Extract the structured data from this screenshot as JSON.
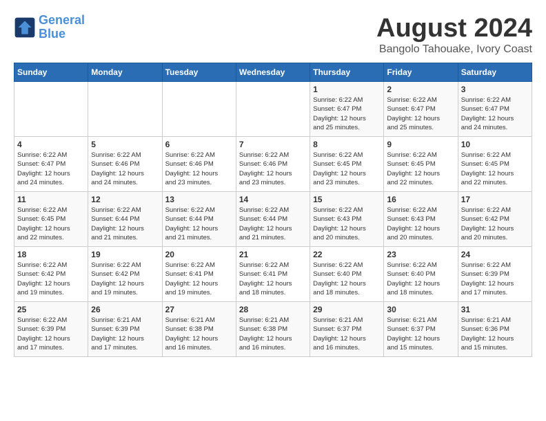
{
  "header": {
    "logo_line1": "General",
    "logo_line2": "Blue",
    "month": "August 2024",
    "location": "Bangolo Tahouake, Ivory Coast"
  },
  "weekdays": [
    "Sunday",
    "Monday",
    "Tuesday",
    "Wednesday",
    "Thursday",
    "Friday",
    "Saturday"
  ],
  "weeks": [
    [
      {
        "day": "",
        "info": ""
      },
      {
        "day": "",
        "info": ""
      },
      {
        "day": "",
        "info": ""
      },
      {
        "day": "",
        "info": ""
      },
      {
        "day": "1",
        "info": "Sunrise: 6:22 AM\nSunset: 6:47 PM\nDaylight: 12 hours\nand 25 minutes."
      },
      {
        "day": "2",
        "info": "Sunrise: 6:22 AM\nSunset: 6:47 PM\nDaylight: 12 hours\nand 25 minutes."
      },
      {
        "day": "3",
        "info": "Sunrise: 6:22 AM\nSunset: 6:47 PM\nDaylight: 12 hours\nand 24 minutes."
      }
    ],
    [
      {
        "day": "4",
        "info": "Sunrise: 6:22 AM\nSunset: 6:47 PM\nDaylight: 12 hours\nand 24 minutes."
      },
      {
        "day": "5",
        "info": "Sunrise: 6:22 AM\nSunset: 6:46 PM\nDaylight: 12 hours\nand 24 minutes."
      },
      {
        "day": "6",
        "info": "Sunrise: 6:22 AM\nSunset: 6:46 PM\nDaylight: 12 hours\nand 23 minutes."
      },
      {
        "day": "7",
        "info": "Sunrise: 6:22 AM\nSunset: 6:46 PM\nDaylight: 12 hours\nand 23 minutes."
      },
      {
        "day": "8",
        "info": "Sunrise: 6:22 AM\nSunset: 6:45 PM\nDaylight: 12 hours\nand 23 minutes."
      },
      {
        "day": "9",
        "info": "Sunrise: 6:22 AM\nSunset: 6:45 PM\nDaylight: 12 hours\nand 22 minutes."
      },
      {
        "day": "10",
        "info": "Sunrise: 6:22 AM\nSunset: 6:45 PM\nDaylight: 12 hours\nand 22 minutes."
      }
    ],
    [
      {
        "day": "11",
        "info": "Sunrise: 6:22 AM\nSunset: 6:45 PM\nDaylight: 12 hours\nand 22 minutes."
      },
      {
        "day": "12",
        "info": "Sunrise: 6:22 AM\nSunset: 6:44 PM\nDaylight: 12 hours\nand 21 minutes."
      },
      {
        "day": "13",
        "info": "Sunrise: 6:22 AM\nSunset: 6:44 PM\nDaylight: 12 hours\nand 21 minutes."
      },
      {
        "day": "14",
        "info": "Sunrise: 6:22 AM\nSunset: 6:44 PM\nDaylight: 12 hours\nand 21 minutes."
      },
      {
        "day": "15",
        "info": "Sunrise: 6:22 AM\nSunset: 6:43 PM\nDaylight: 12 hours\nand 20 minutes."
      },
      {
        "day": "16",
        "info": "Sunrise: 6:22 AM\nSunset: 6:43 PM\nDaylight: 12 hours\nand 20 minutes."
      },
      {
        "day": "17",
        "info": "Sunrise: 6:22 AM\nSunset: 6:42 PM\nDaylight: 12 hours\nand 20 minutes."
      }
    ],
    [
      {
        "day": "18",
        "info": "Sunrise: 6:22 AM\nSunset: 6:42 PM\nDaylight: 12 hours\nand 19 minutes."
      },
      {
        "day": "19",
        "info": "Sunrise: 6:22 AM\nSunset: 6:42 PM\nDaylight: 12 hours\nand 19 minutes."
      },
      {
        "day": "20",
        "info": "Sunrise: 6:22 AM\nSunset: 6:41 PM\nDaylight: 12 hours\nand 19 minutes."
      },
      {
        "day": "21",
        "info": "Sunrise: 6:22 AM\nSunset: 6:41 PM\nDaylight: 12 hours\nand 18 minutes."
      },
      {
        "day": "22",
        "info": "Sunrise: 6:22 AM\nSunset: 6:40 PM\nDaylight: 12 hours\nand 18 minutes."
      },
      {
        "day": "23",
        "info": "Sunrise: 6:22 AM\nSunset: 6:40 PM\nDaylight: 12 hours\nand 18 minutes."
      },
      {
        "day": "24",
        "info": "Sunrise: 6:22 AM\nSunset: 6:39 PM\nDaylight: 12 hours\nand 17 minutes."
      }
    ],
    [
      {
        "day": "25",
        "info": "Sunrise: 6:22 AM\nSunset: 6:39 PM\nDaylight: 12 hours\nand 17 minutes."
      },
      {
        "day": "26",
        "info": "Sunrise: 6:21 AM\nSunset: 6:39 PM\nDaylight: 12 hours\nand 17 minutes."
      },
      {
        "day": "27",
        "info": "Sunrise: 6:21 AM\nSunset: 6:38 PM\nDaylight: 12 hours\nand 16 minutes."
      },
      {
        "day": "28",
        "info": "Sunrise: 6:21 AM\nSunset: 6:38 PM\nDaylight: 12 hours\nand 16 minutes."
      },
      {
        "day": "29",
        "info": "Sunrise: 6:21 AM\nSunset: 6:37 PM\nDaylight: 12 hours\nand 16 minutes."
      },
      {
        "day": "30",
        "info": "Sunrise: 6:21 AM\nSunset: 6:37 PM\nDaylight: 12 hours\nand 15 minutes."
      },
      {
        "day": "31",
        "info": "Sunrise: 6:21 AM\nSunset: 6:36 PM\nDaylight: 12 hours\nand 15 minutes."
      }
    ]
  ]
}
